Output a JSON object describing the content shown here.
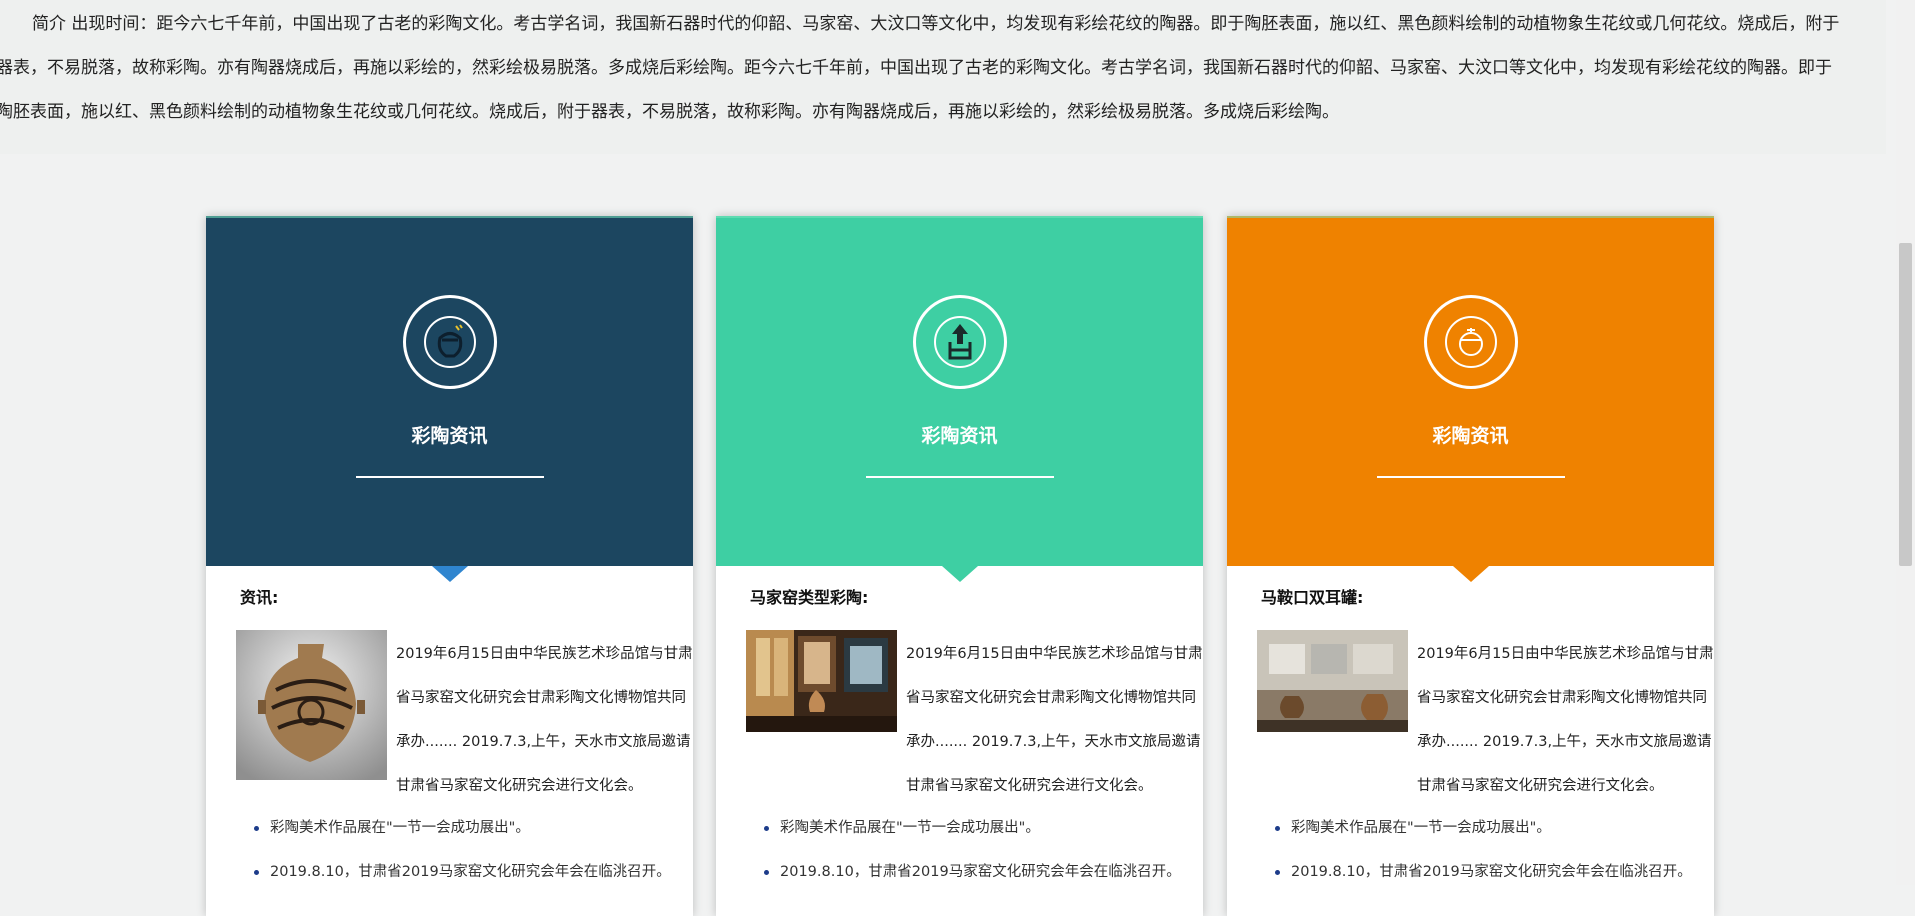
{
  "intro": {
    "line1": "简介 出现时间：距今六七千年前，中国出现了古老的彩陶文化。考古学名词，我国新石器时代的仰韶、马家窑、大汶口等文化中，均发现有彩绘花纹的陶器。即于陶胚表面，施以红、黑色颜料绘制的动植物象生花纹或几何花纹。烧成后，附于",
    "line2": "器表，不易脱落，故称彩陶。亦有陶器烧成后，再施以彩绘的，然彩绘极易脱落。多成烧后彩绘陶。距今六七千年前，中国出现了古老的彩陶文化。考古学名词，我国新石器时代的仰韶、马家窑、大汶口等文化中，均发现有彩绘花纹的陶器。即于",
    "line3": "陶胚表面，施以红、黑色颜料绘制的动植物象生花纹或几何花纹。烧成后，附于器表，不易脱落，故称彩陶。亦有陶器烧成后，再施以彩绘的，然彩绘极易脱落。多成烧后彩绘陶。"
  },
  "colors": {
    "card1": "#1c4660",
    "card2": "#3ecfa3",
    "card3": "#ef8200",
    "pointer1": "#2f85cf",
    "pointer2": "#3ecfa3",
    "pointer3": "#ef8200"
  },
  "cards": [
    {
      "title": "彩陶资讯",
      "icon": "pottery-jar-icon",
      "subtitle": "资讯:",
      "desc": "2019年6月15日由中华民族艺术珍品馆与甘肃省马家窑文化研究会甘肃彩陶文化博物馆共同承办....... 2019.7.3,上午，天水市文旅局邀请甘肃省马家窑文化研究会进行文化会。",
      "bullets": [
        "彩陶美术作品展在\"一节一会成功展出\"。",
        "2019.8.10，甘肃省2019马家窑文化研究会年会在临洮召开。"
      ]
    },
    {
      "title": "彩陶资讯",
      "icon": "pottery-upload-icon",
      "subtitle": "马家窑类型彩陶:",
      "desc": "2019年6月15日由中华民族艺术珍品馆与甘肃省马家窑文化研究会甘肃彩陶文化博物馆共同承办....... 2019.7.3,上午，天水市文旅局邀请甘肃省马家窑文化研究会进行文化会。",
      "bullets": [
        "彩陶美术作品展在\"一节一会成功展出\"。",
        "2019.8.10，甘肃省2019马家窑文化研究会年会在临洮召开。"
      ]
    },
    {
      "title": "彩陶资讯",
      "icon": "pottery-pot-icon",
      "subtitle": "马鞍口双耳罐:",
      "desc": "2019年6月15日由中华民族艺术珍品馆与甘肃省马家窑文化研究会甘肃彩陶文化博物馆共同承办....... 2019.7.3,上午，天水市文旅局邀请甘肃省马家窑文化研究会进行文化会。",
      "bullets": [
        "彩陶美术作品展在\"一节一会成功展出\"。",
        "2019.8.10，甘肃省2019马家窑文化研究会年会在临洮召开。"
      ]
    }
  ]
}
